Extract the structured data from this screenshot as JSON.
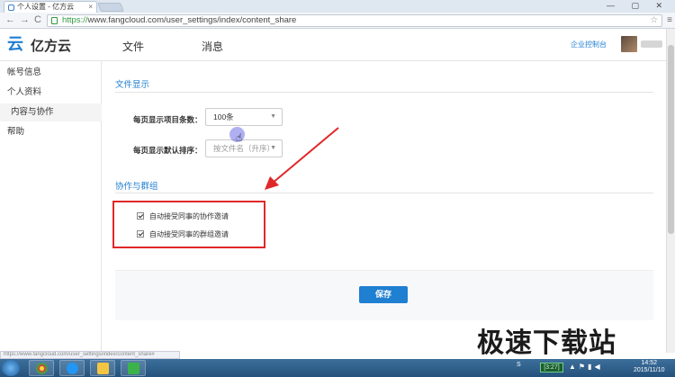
{
  "browser": {
    "tab_title": "个人设置 - 亿方云",
    "tab_close": "×",
    "window_buttons": "— ▢ ✕",
    "url_scheme": "https://",
    "url_rest": "www.fangcloud.com/user_settings/index/content_share",
    "back": "←",
    "forward": "→",
    "reload": "C",
    "star": "☆",
    "menu": "≡",
    "status_url": "https://www.fangcloud.com/user_settings/index/content_share#"
  },
  "header": {
    "logo_text": "亿方云",
    "logo_mark": "云",
    "nav": [
      "文件",
      "消息"
    ],
    "enterprise_console": "企业控制台"
  },
  "sidebar": {
    "items": [
      {
        "label": "帐号信息"
      },
      {
        "label": "个人资料"
      },
      {
        "label": "内容与协作"
      },
      {
        "label": "帮助"
      }
    ]
  },
  "file_display": {
    "title": "文件显示",
    "items_per_page_label": "每页显示项目条数：",
    "items_per_page_value": "100条",
    "default_sort_label": "每页显示默认排序：",
    "default_sort_value": "按文件名（升序）"
  },
  "collab": {
    "title": "协作与群组",
    "options": [
      {
        "label": "自动接受同事的协作邀请",
        "checked": true
      },
      {
        "label": "自动接受同事的群组邀请",
        "checked": true
      }
    ]
  },
  "actions": {
    "save_label": "保存"
  },
  "taskbar": {
    "tray_chip": "[3:27]",
    "time": "14:52",
    "date": "2015/11/10"
  },
  "watermark": "极速下载站",
  "colors": {
    "accent": "#1f7fd1",
    "highlight_box": "#e02828"
  }
}
